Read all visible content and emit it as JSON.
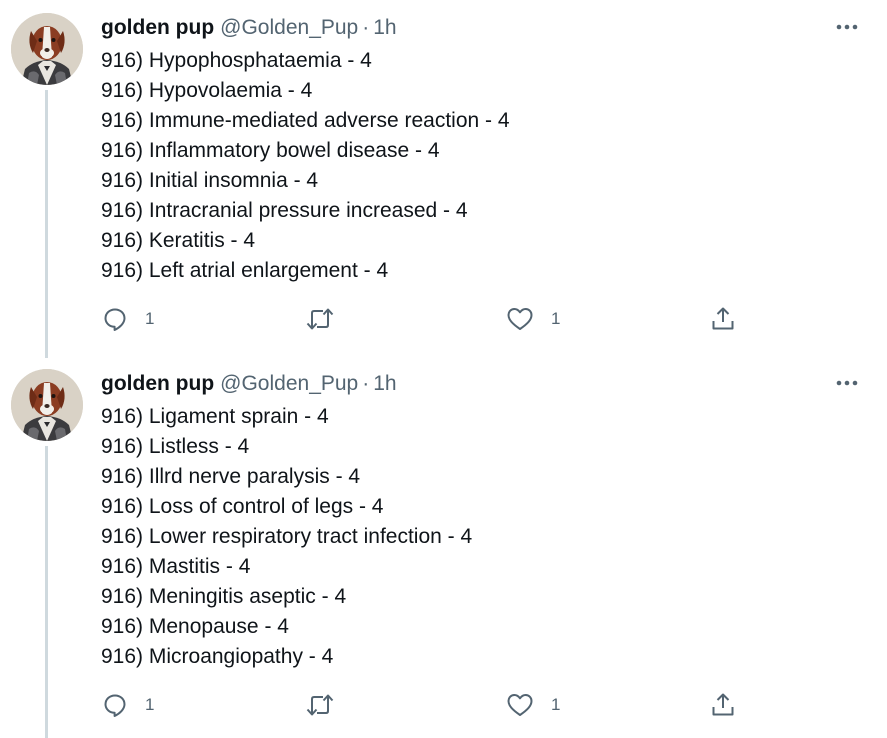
{
  "tweets": [
    {
      "display_name": "golden pup",
      "handle": "@Golden_Pup",
      "separator": "·",
      "time": "1h",
      "lines": [
        "916) Hypophosphataemia - 4",
        "916) Hypovolaemia - 4",
        "916) Immune-mediated adverse reaction - 4",
        "916) Inflammatory bowel disease - 4",
        "916) Initial insomnia - 4",
        "916) Intracranial pressure increased - 4",
        "916) Keratitis - 4",
        "916) Left atrial enlargement - 4"
      ],
      "reply_count": "1",
      "retweet_count": "",
      "like_count": "1"
    },
    {
      "display_name": "golden pup",
      "handle": "@Golden_Pup",
      "separator": "·",
      "time": "1h",
      "lines": [
        "916) Ligament sprain - 4",
        "916) Listless - 4",
        "916) Illrd nerve paralysis - 4",
        "916) Loss of control of legs - 4",
        "916) Lower respiratory tract infection - 4",
        "916) Mastitis - 4",
        "916) Meningitis aseptic - 4",
        "916) Menopause - 4",
        "916) Microangiopathy - 4"
      ],
      "reply_count": "1",
      "retweet_count": "",
      "like_count": "1"
    }
  ],
  "colors": {
    "text_primary": "#0f1419",
    "text_secondary": "#536471",
    "thread_line": "#cfd9de",
    "background": "#ffffff"
  },
  "icons": {
    "avatar": "dog-in-suit-avatar",
    "more": "more-horizontal-icon",
    "reply": "reply-icon",
    "retweet": "retweet-icon",
    "like": "heart-icon",
    "share": "share-icon"
  }
}
